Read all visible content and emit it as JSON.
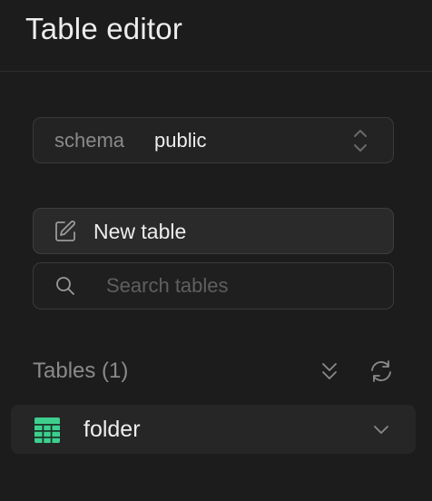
{
  "header": {
    "title": "Table editor"
  },
  "schema": {
    "label": "schema",
    "value": "public"
  },
  "actions": {
    "new_table_label": "New table"
  },
  "search": {
    "placeholder": "Search tables",
    "value": ""
  },
  "tables": {
    "section_title": "Tables (1)",
    "items": [
      {
        "name": "folder"
      }
    ]
  },
  "colors": {
    "background": "#1c1c1c",
    "table_icon": "#3ecf8e",
    "muted_text": "#8a8a8a"
  },
  "icons": {
    "schema_select": "chevron-up-down-icon",
    "new_table": "edit-icon",
    "search": "search-icon",
    "collapse_all": "chevrons-down-icon",
    "refresh": "refresh-icon",
    "table": "table-grid-icon",
    "row_expand": "chevron-down-icon"
  }
}
